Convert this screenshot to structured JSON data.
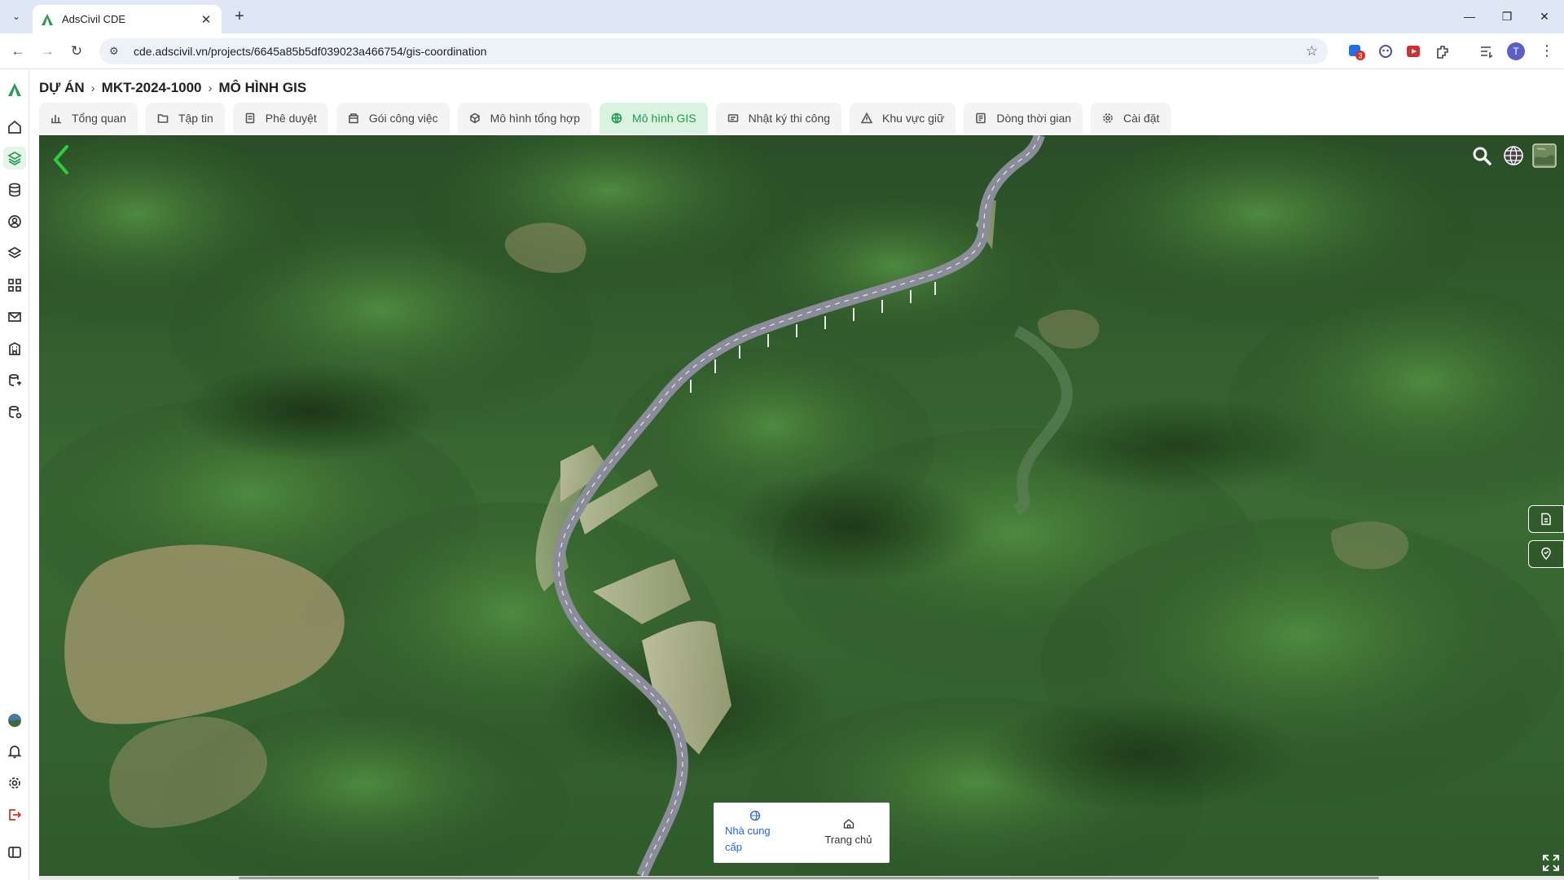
{
  "browser": {
    "tab_title": "AdsCivil CDE",
    "url": "cde.adscivil.vn/projects/6645a85b5df039023a466754/gis-coordination",
    "extension_badge": "3",
    "profile_initial": "T"
  },
  "breadcrumb": {
    "root": "DỰ ÁN",
    "project": "MKT-2024-1000",
    "current": "MÔ HÌNH GIS"
  },
  "tabs": [
    {
      "label": "Tổng quan",
      "icon": "chart-icon"
    },
    {
      "label": "Tập tin",
      "icon": "folder-icon"
    },
    {
      "label": "Phê duyệt",
      "icon": "approval-icon"
    },
    {
      "label": "Gói công việc",
      "icon": "package-icon"
    },
    {
      "label": "Mô hình tổng hợp",
      "icon": "model-icon"
    },
    {
      "label": "Mô hình GIS",
      "icon": "globe-icon",
      "active": true
    },
    {
      "label": "Nhật ký thi công",
      "icon": "log-icon"
    },
    {
      "label": "Khu vực giữ",
      "icon": "warning-icon"
    },
    {
      "label": "Dòng thời gian",
      "icon": "timeline-icon"
    },
    {
      "label": "Cài đặt",
      "icon": "gear-icon"
    }
  ],
  "map_panel": {
    "provider_label": "Nhà cung cấp",
    "home_label": "Trang chủ"
  },
  "colors": {
    "accent": "#1f9a4f",
    "active_tab_bg": "#daf3e1",
    "link": "#2566d6"
  }
}
